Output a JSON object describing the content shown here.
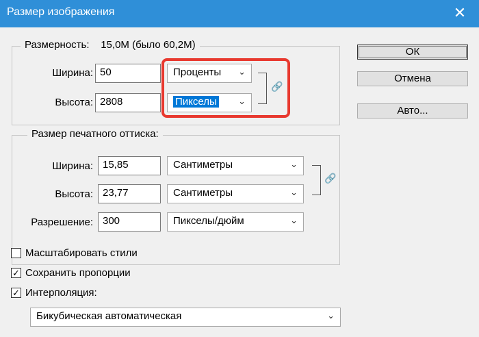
{
  "window": {
    "title": "Размер изображения",
    "close": "✕"
  },
  "pixel_dimensions": {
    "legend_label": "Размерность:",
    "legend_value": "15,0M (было 60,2M)",
    "width_label": "Ширина:",
    "width_value": "50",
    "width_unit": "Проценты",
    "height_label": "Высота:",
    "height_value": "2808",
    "height_unit": "Пикселы"
  },
  "document_size": {
    "legend": "Размер печатного оттиска:",
    "width_label": "Ширина:",
    "width_value": "15,85",
    "width_unit": "Сантиметры",
    "height_label": "Высота:",
    "height_value": "23,77",
    "height_unit": "Сантиметры",
    "resolution_label": "Разрешение:",
    "resolution_value": "300",
    "resolution_unit": "Пикселы/дюйм"
  },
  "buttons": {
    "ok": "ОК",
    "cancel": "Отмена",
    "auto": "Авто..."
  },
  "options": {
    "scale_styles": {
      "label": "Масштабировать стили",
      "checked": false
    },
    "constrain": {
      "label": "Сохранить пропорции",
      "checked": true
    },
    "resample": {
      "label": "Интерполяция:",
      "checked": true
    },
    "resample_method": "Бикубическая автоматическая"
  },
  "colors": {
    "titlebar": "#2f8fd8",
    "highlight": "#e8392f",
    "selection": "#0078d7"
  }
}
